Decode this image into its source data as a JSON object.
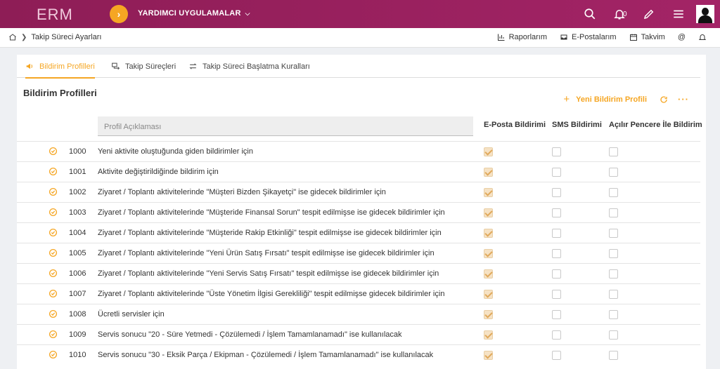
{
  "topbar": {
    "logo": "ERM",
    "apps_label": "YARDIMCI UYGULAMALAR",
    "notification_count": "0",
    "colors": {
      "bar": "#9b2160",
      "accent": "#f5a623"
    }
  },
  "breadcrumb": {
    "home_icon": "home-icon",
    "current": "Takip Süreci Ayarları"
  },
  "quick_links": {
    "reports": "Raporlarım",
    "emails": "E-Postalarım",
    "calendar": "Takvim",
    "at_icon": "@"
  },
  "tabs": [
    {
      "label": "Bildirim Profilleri",
      "icon": "megaphone-icon",
      "active": true
    },
    {
      "label": "Takip Süreçleri",
      "icon": "process-icon",
      "active": false
    },
    {
      "label": "Takip Süreci Başlatma Kuralları",
      "icon": "swap-icon",
      "active": false
    }
  ],
  "section": {
    "title": "Bildirim Profilleri",
    "new_label": "Yeni Bildirim Profili",
    "more_label": "···"
  },
  "table": {
    "filter_placeholder": "Profil Açıklaması",
    "columns": {
      "email": "E-Posta Bildirimi",
      "sms": "SMS Bildirimi",
      "popup": "Açılır Pencere İle Bildirim"
    },
    "rows": [
      {
        "code": "1000",
        "desc": "Yeni aktivite oluştuğunda giden bildirimler için",
        "email": true,
        "sms": false,
        "popup": false
      },
      {
        "code": "1001",
        "desc": "Aktivite değiştirildiğinde bildirim için",
        "email": true,
        "sms": false,
        "popup": false
      },
      {
        "code": "1002",
        "desc": "Ziyaret / Toplantı aktivitelerinde \"Müşteri Bizden Şikayetçi\" ise gidecek bildirimler için",
        "email": true,
        "sms": false,
        "popup": false
      },
      {
        "code": "1003",
        "desc": "Ziyaret / Toplantı aktivitelerinde \"Müşteride Finansal Sorun\" tespit edilmişse ise gidecek bildirimler için",
        "email": true,
        "sms": false,
        "popup": false
      },
      {
        "code": "1004",
        "desc": "Ziyaret / Toplantı aktivitelerinde \"Müşteride Rakip Etkinliği\" tespit edilmişse ise gidecek bildirimler için",
        "email": true,
        "sms": false,
        "popup": false
      },
      {
        "code": "1005",
        "desc": "Ziyaret / Toplantı aktivitelerinde \"Yeni Ürün Satış Fırsatı\" tespit edilmişse ise gidecek bildirimler için",
        "email": true,
        "sms": false,
        "popup": false
      },
      {
        "code": "1006",
        "desc": "Ziyaret / Toplantı aktivitelerinde \"Yeni Servis Satış Fırsatı\" tespit edilmişse ise gidecek bildirimler için",
        "email": true,
        "sms": false,
        "popup": false
      },
      {
        "code": "1007",
        "desc": "Ziyaret / Toplantı aktivitelerinde \"Üste Yönetim İlgisi Gerekliliği\" tespit edilmişse gidecek bildirimler için",
        "email": true,
        "sms": false,
        "popup": false
      },
      {
        "code": "1008",
        "desc": "Ücretli servisler için",
        "email": true,
        "sms": false,
        "popup": false
      },
      {
        "code": "1009",
        "desc": "Servis sonucu \"20 - Süre Yetmedi - Çözülemedi / İşlem Tamamlanamadı\" ise kullanılacak",
        "email": true,
        "sms": false,
        "popup": false
      },
      {
        "code": "1010",
        "desc": "Servis sonucu \"30 - Eksik Parça / Ekipman - Çözülemedi / İşlem Tamamlanamadı\" ise kullanılacak",
        "email": true,
        "sms": false,
        "popup": false
      }
    ]
  }
}
